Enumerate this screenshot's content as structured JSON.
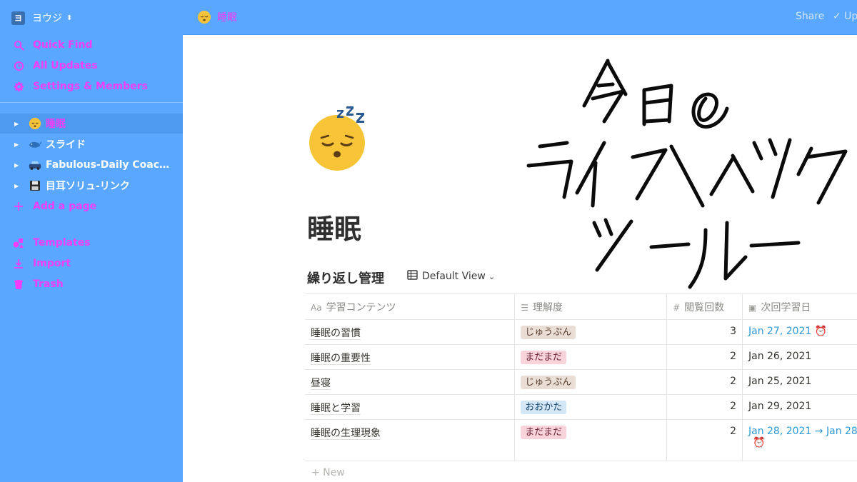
{
  "sidebar": {
    "workspace_name": "ヨウジ",
    "workspace_logo": "ヨ",
    "links": [
      {
        "label": "Quick Find",
        "icon": "search-icon"
      },
      {
        "label": "All Updates",
        "icon": "clock-icon"
      },
      {
        "label": "Settings & Members",
        "icon": "gear-icon"
      }
    ],
    "pages": [
      {
        "label": "睡眠",
        "icon": "sleeping-face-icon"
      },
      {
        "label": "スライド",
        "icon": "whale-icon"
      },
      {
        "label": "Fabulous-Daily Coachin...",
        "icon": "car-icon"
      },
      {
        "label": "目耳ソリュ-リンク",
        "icon": "floppy-disk-icon"
      }
    ],
    "add_page": "Add a page",
    "bottom_links": [
      {
        "label": "Templates",
        "icon": "templates-icon"
      },
      {
        "label": "Import",
        "icon": "download-icon"
      },
      {
        "label": "Trash",
        "icon": "trash-icon"
      }
    ]
  },
  "topbar": {
    "breadcrumb": "睡眠",
    "share_label": "Share",
    "updates_label": "✓ Up"
  },
  "page": {
    "title": "睡眠",
    "headline_lines": [
      "今日の",
      "ライフハック",
      "ツール"
    ],
    "database": {
      "title": "繰り返し管理",
      "view_label": "Default View",
      "columns": [
        "学習コンテンツ",
        "理解度",
        "閲覧回数",
        "次回学習日"
      ],
      "rows": [
        {
          "content": "睡眠の習慣",
          "level": "じゅうぶん",
          "tag": "brown",
          "count": "3",
          "date": "Jan 27, 2021",
          "date_style": "blue",
          "alarm": true
        },
        {
          "content": "睡眠の重要性",
          "level": "まだまだ",
          "tag": "pink",
          "count": "2",
          "date": "Jan 26, 2021",
          "date_style": "plain",
          "alarm": false
        },
        {
          "content": "昼寝",
          "level": "じゅうぶん",
          "tag": "brown",
          "count": "2",
          "date": "Jan 25, 2021",
          "date_style": "plain",
          "alarm": false
        },
        {
          "content": "睡眠と学習",
          "level": "おおかた",
          "tag": "blue",
          "count": "2",
          "date": "Jan 29, 2021",
          "date_style": "plain",
          "alarm": false
        },
        {
          "content": "睡眠の生理現象",
          "level": "まだまだ",
          "tag": "pink",
          "count": "2",
          "date": "Jan 28, 2021 → Jan 28,",
          "date_style": "blue",
          "alarm": true
        }
      ],
      "new_label": "+ New"
    }
  },
  "colors": {
    "sidebar_bg": "#5aa7ff",
    "accent_pink": "#f43df6",
    "date_blue": "#2e9ad8"
  }
}
